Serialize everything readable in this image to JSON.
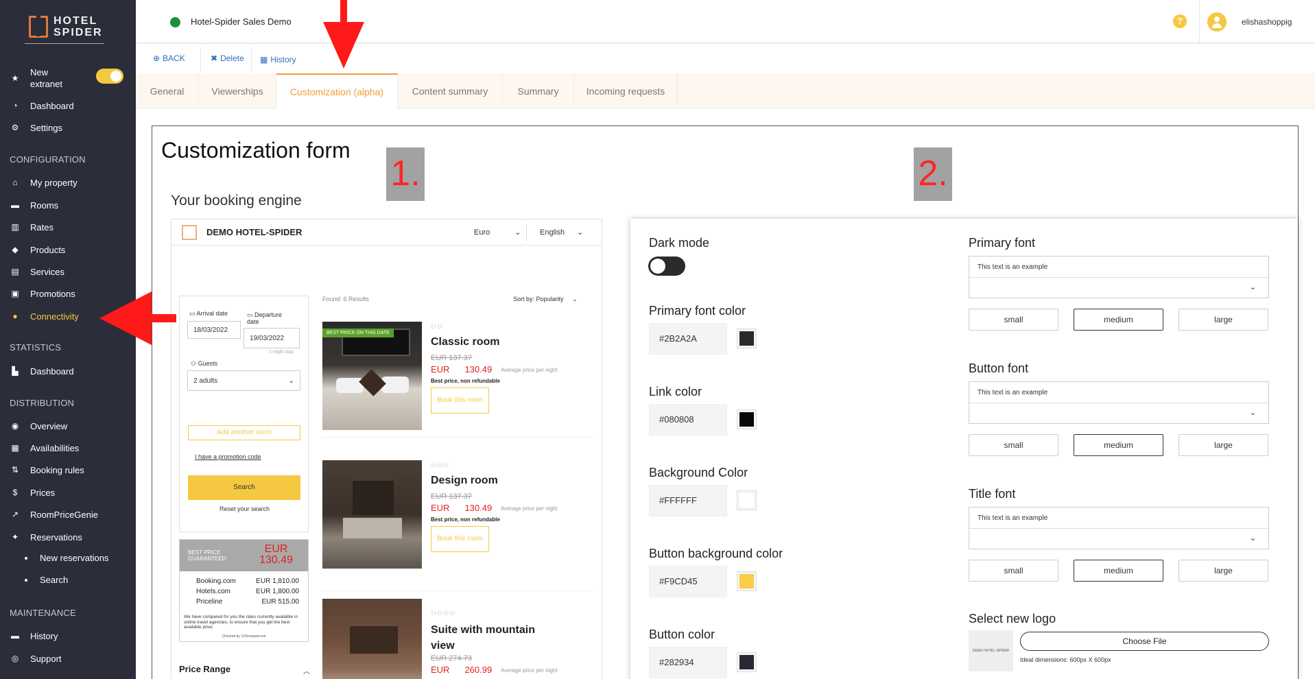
{
  "sidebar": {
    "logo_text": "HOTEL SPIDER",
    "new_extranet_label": "New extranet",
    "items": [
      {
        "label": "Dashboard",
        "icon": "dashboard-icon"
      },
      {
        "label": "Settings",
        "icon": "gear-icon"
      }
    ],
    "configuration_header": "CONFIGURATION",
    "configuration_items": [
      {
        "label": "My property",
        "icon": "home-icon"
      },
      {
        "label": "Rooms",
        "icon": "bed-icon"
      },
      {
        "label": "Rates",
        "icon": "barcode-icon"
      },
      {
        "label": "Products",
        "icon": "tags-icon"
      },
      {
        "label": "Services",
        "icon": "cart-icon"
      },
      {
        "label": "Promotions",
        "icon": "gift-icon"
      },
      {
        "label": "Connectivity",
        "icon": "globe-icon"
      }
    ],
    "statistics_header": "STATISTICS",
    "statistics_items": [
      {
        "label": "Dashboard",
        "icon": "chart-icon"
      }
    ],
    "distribution_header": "DISTRIBUTION",
    "distribution_items": [
      {
        "label": "Overview",
        "icon": "eye-icon"
      },
      {
        "label": "Availabilities",
        "icon": "calendar-check-icon"
      },
      {
        "label": "Booking rules",
        "icon": "sort-icon"
      },
      {
        "label": "Prices",
        "icon": "dollar-icon"
      },
      {
        "label": "RoomPriceGenie",
        "icon": "line-chart-icon"
      },
      {
        "label": "Reservations",
        "icon": "pin-icon"
      }
    ],
    "reservation_subitems": [
      {
        "label": "New reservations"
      },
      {
        "label": "Search"
      }
    ],
    "maintenance_header": "MAINTENANCE",
    "maintenance_items": [
      {
        "label": "History",
        "icon": "history-icon"
      },
      {
        "label": "Support",
        "icon": "support-icon"
      }
    ],
    "colors": {
      "background": "#2b2d3a",
      "active": "#f5c842"
    }
  },
  "topbar": {
    "hotel_name": "Hotel-Spider Sales Demo",
    "status_color": "#1a8f3c",
    "help_label": "?",
    "username": "elishashoppig"
  },
  "actions": {
    "back": "BACK",
    "delete": "Delete",
    "history": "History"
  },
  "tabs": [
    {
      "label": "General"
    },
    {
      "label": "Viewerships"
    },
    {
      "label": "Customization (alpha)"
    },
    {
      "label": "Content summary"
    },
    {
      "label": "Summary"
    },
    {
      "label": "Incoming requests"
    }
  ],
  "main": {
    "form_title": "Customization form",
    "engine_title": "Your booking engine",
    "marker1": "1.",
    "marker2": "2."
  },
  "preview": {
    "hotel_name": "DEMO HOTEL-SPIDER",
    "currency": "Euro",
    "language": "English",
    "arrival_label": "Arrival date",
    "arrival_value": "18/03/2022",
    "departure_label": "Departure date",
    "departure_value": "19/03/2022",
    "nights": "1-night stay",
    "guests_label": "Guests",
    "guests_value": "2 adults",
    "add_room": "Add another room",
    "promo": "I have a promotion code",
    "search": "Search",
    "reset": "Reset your search",
    "best_price": "BEST PRICE GUARANTEED",
    "best_currency": "EUR",
    "best_amount": "130.49",
    "compare": [
      {
        "site": "Booking.com",
        "price": "EUR 1,810.00"
      },
      {
        "site": "Hotels.com",
        "price": "EUR 1,800.00"
      },
      {
        "site": "Priceline",
        "price": "EUR 515.00"
      }
    ],
    "compare_note": "We have compared for you the rates currently available in online travel agencies, to ensure that you get the best available price.",
    "checked_by": "Checked by 123compare.me",
    "price_range": "Price Range",
    "found": "Found: 6 Results",
    "sort": "Sort by: Popularity",
    "badge": "BEST PRICE ON THIS DATE",
    "rooms": [
      {
        "name": "Classic room",
        "old": "EUR 137.37",
        "currency": "EUR",
        "price": "130.49",
        "avg": "Average price per night",
        "note": "Best price, non refundable",
        "button": "Book this room"
      },
      {
        "name": "Design room",
        "old": "EUR 137.37",
        "currency": "EUR",
        "price": "130.49",
        "avg": "Average price per night",
        "note": "Best price, non refundable",
        "button": "Book this room"
      },
      {
        "name": "Suite with mountain view",
        "old": "EUR 274.73",
        "currency": "EUR",
        "price": "260.99",
        "avg": "Average price per night"
      }
    ],
    "accent": "#f5c842",
    "price_color": "#e1211d"
  },
  "settings": {
    "dark_mode": "Dark mode",
    "primary_font_color": {
      "label": "Primary font color",
      "value": "#2B2A2A"
    },
    "link_color": {
      "label": "Link color",
      "value": "#080808"
    },
    "background_color": {
      "label": "Background Color",
      "value": "#FFFFFF"
    },
    "button_bg_color": {
      "label": "Button background color",
      "value": "#F9CD45"
    },
    "button_color": {
      "label": "Button color",
      "value": "#282934"
    },
    "fonts": [
      {
        "label": "Primary font",
        "example": "This text is an example"
      },
      {
        "label": "Button font",
        "example": "This text is an example"
      },
      {
        "label": "Title font",
        "example": "This text is an example"
      }
    ],
    "sizes": [
      "small",
      "medium",
      "large"
    ],
    "selected_size": "medium",
    "logo_label": "Select new logo",
    "choose_file": "Choose File",
    "ideal": "Ideal dimensions: 600px X 600px",
    "logo_thumb_text": "DEMO HOTEL-SPIDER"
  },
  "arrow_color": "#ff1a1a"
}
